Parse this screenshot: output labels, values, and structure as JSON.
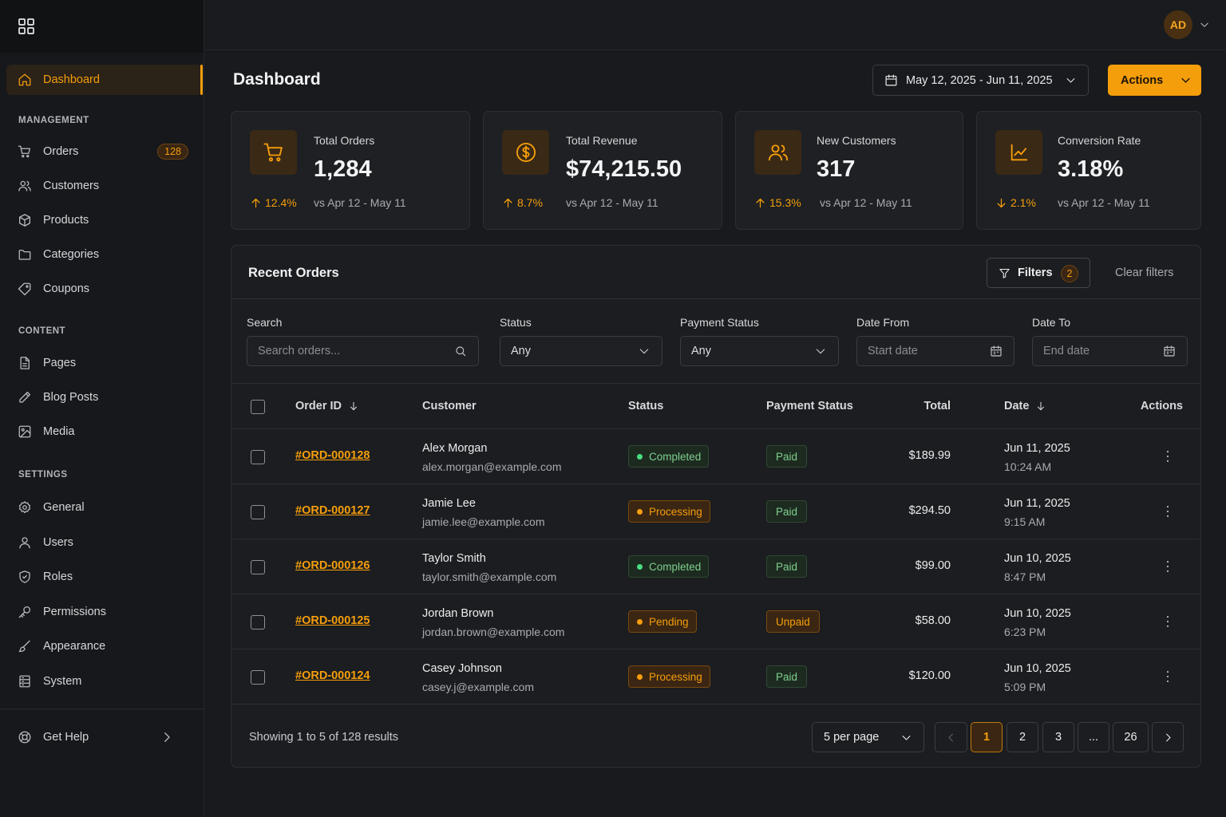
{
  "sidebar": {
    "top": {
      "label": "Dashboard"
    },
    "management_label": "MANAGEMENT",
    "management": [
      {
        "label": "Orders",
        "badge": "128"
      },
      {
        "label": "Customers"
      },
      {
        "label": "Products"
      },
      {
        "label": "Categories"
      },
      {
        "label": "Coupons"
      }
    ],
    "content_label": "CONTENT",
    "content": [
      {
        "label": "Pages"
      },
      {
        "label": "Blog Posts"
      },
      {
        "label": "Media"
      }
    ],
    "settings_label": "SETTINGS",
    "settings": [
      {
        "label": "General"
      },
      {
        "label": "Users"
      },
      {
        "label": "Roles"
      },
      {
        "label": "Permissions"
      },
      {
        "label": "Appearance"
      },
      {
        "label": "System"
      }
    ],
    "help": {
      "label": "Get Help"
    }
  },
  "header": {
    "avatar_initials": "AD"
  },
  "page": {
    "title": "Dashboard",
    "date_range": "May 12, 2025 - Jun 11, 2025",
    "actions_label": "Actions"
  },
  "stats": [
    {
      "label": "Total Orders",
      "value": "1,284",
      "delta": "12.4%",
      "direction": "up",
      "compare": "vs Apr 12 - May 11",
      "icon": "cart-icon"
    },
    {
      "label": "Total Revenue",
      "value": "$74,215.50",
      "delta": "8.7%",
      "direction": "up",
      "compare": "vs Apr 12 - May 11",
      "icon": "dollar-icon"
    },
    {
      "label": "New Customers",
      "value": "317",
      "delta": "15.3%",
      "direction": "up",
      "compare": "vs Apr 12 - May 11",
      "icon": "users-icon"
    },
    {
      "label": "Conversion Rate",
      "value": "3.18%",
      "delta": "2.1%",
      "direction": "down",
      "compare": "vs Apr 12 - May 11",
      "icon": "chart-line-icon"
    }
  ],
  "orders": {
    "title": "Recent Orders",
    "filters_label": "Filters",
    "filters_count": "2",
    "clear_filters": "Clear filters",
    "filters": {
      "search_label": "Search",
      "search_placeholder": "Search orders...",
      "status_label": "Status",
      "status_value": "Any",
      "payment_label": "Payment Status",
      "payment_value": "Any",
      "date_from_label": "Date From",
      "date_from_placeholder": "Start date",
      "date_to_label": "Date To",
      "date_to_placeholder": "End date"
    },
    "columns": {
      "order_id": "Order ID",
      "customer": "Customer",
      "status": "Status",
      "payment": "Payment Status",
      "total": "Total",
      "date": "Date",
      "actions": "Actions"
    },
    "rows": [
      {
        "id": "#ORD-000128",
        "name": "Alex Morgan",
        "email": "alex.morgan@example.com",
        "status": "Completed",
        "status_kind": "completed",
        "payment": "Paid",
        "payment_kind": "paid",
        "total": "$189.99",
        "date": "Jun 11, 2025",
        "time": "10:24 AM"
      },
      {
        "id": "#ORD-000127",
        "name": "Jamie Lee",
        "email": "jamie.lee@example.com",
        "status": "Processing",
        "status_kind": "processing",
        "payment": "Paid",
        "payment_kind": "paid",
        "total": "$294.50",
        "date": "Jun 11, 2025",
        "time": "9:15 AM"
      },
      {
        "id": "#ORD-000126",
        "name": "Taylor Smith",
        "email": "taylor.smith@example.com",
        "status": "Completed",
        "status_kind": "completed",
        "payment": "Paid",
        "payment_kind": "paid",
        "total": "$99.00",
        "date": "Jun 10, 2025",
        "time": "8:47 PM"
      },
      {
        "id": "#ORD-000125",
        "name": "Jordan Brown",
        "email": "jordan.brown@example.com",
        "status": "Pending",
        "status_kind": "pending",
        "payment": "Unpaid",
        "payment_kind": "unpaid",
        "total": "$58.00",
        "date": "Jun 10, 2025",
        "time": "6:23 PM"
      },
      {
        "id": "#ORD-000124",
        "name": "Casey Johnson",
        "email": "casey.j@example.com",
        "status": "Processing",
        "status_kind": "processing",
        "payment": "Paid",
        "payment_kind": "paid",
        "total": "$120.00",
        "date": "Jun 10, 2025",
        "time": "5:09 PM"
      }
    ],
    "footer": {
      "showing": "Showing 1 to 5 of 128 results",
      "per_page": "5 per page",
      "pages": [
        "1",
        "2",
        "3",
        "...",
        "26"
      ],
      "current_page": "1"
    }
  },
  "colors": {
    "accent": "#f59e0b",
    "success": "#4ade80",
    "background": "#181a1d"
  }
}
